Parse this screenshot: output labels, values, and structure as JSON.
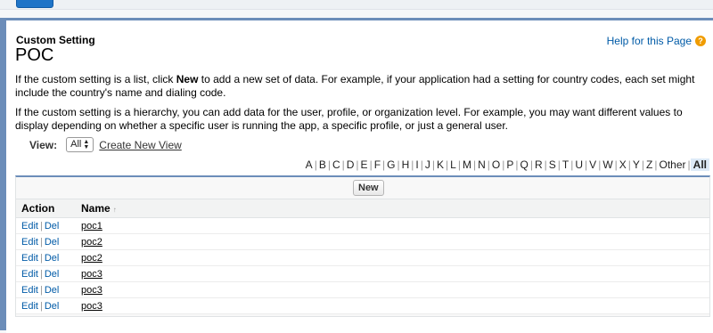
{
  "header": {
    "subtitle": "Custom Setting",
    "title": "POC",
    "help_label": "Help for this Page",
    "help_icon": "question-icon"
  },
  "intro": {
    "p1_before": "If the custom setting is a list, click ",
    "p1_bold": "New",
    "p1_after": " to add a new set of data. For example, if your application had a setting for country codes, each set might include the country's name and dialing code.",
    "p2": "If the custom setting is a hierarchy, you can add data for the user, profile, or organization level. For example, you may want different values to display depending on whether a specific user is running the app, a specific profile, or just a general user."
  },
  "view": {
    "label": "View:",
    "selected": "All",
    "create_link": "Create New View"
  },
  "alphabet": [
    "A",
    "B",
    "C",
    "D",
    "E",
    "F",
    "G",
    "H",
    "I",
    "J",
    "K",
    "L",
    "M",
    "N",
    "O",
    "P",
    "Q",
    "R",
    "S",
    "T",
    "U",
    "V",
    "W",
    "X",
    "Y",
    "Z",
    "Other",
    "All"
  ],
  "alphabet_active": "All",
  "list": {
    "new_button": "New",
    "columns": [
      "Action",
      "Name"
    ],
    "sort_icon": "sort-ascending-icon",
    "edit_label": "Edit",
    "del_label": "Del",
    "rows": [
      "poc1",
      "poc2",
      "poc2",
      "poc3",
      "poc3",
      "poc3"
    ]
  },
  "colors": {
    "accent": "#6c8db9",
    "link": "#015ba7",
    "help_icon": "#f09c00"
  }
}
